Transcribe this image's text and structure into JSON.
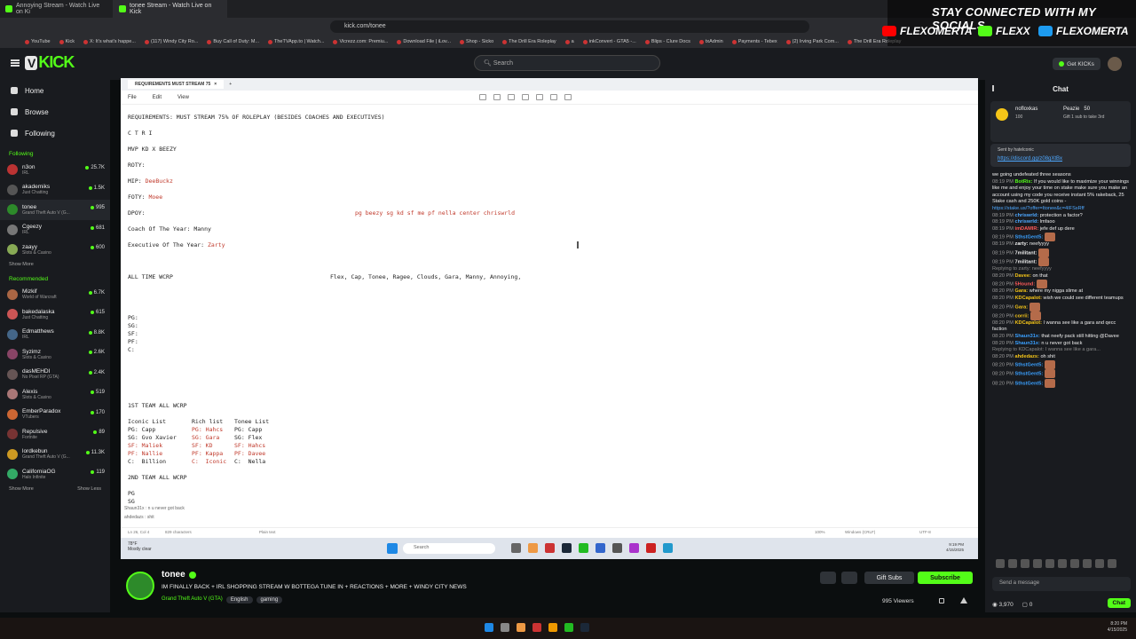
{
  "browser": {
    "tabs": [
      {
        "title": "Annoying Stream - Watch Live on Ki"
      },
      {
        "title": "tonee Stream - Watch Live on Kick"
      }
    ],
    "url": "kick.com/tonee",
    "bookmarks": [
      "YouTube",
      "Kick",
      "X: It's what's happe...",
      "(117) Windy City Ro...",
      "Buy Call of Duty: M...",
      "TheTVApp.to | Watch...",
      "Vicrezz.com: Premiu...",
      "Download File | iLov...",
      "Shop - Sicko",
      "The Drill Era Roleplay",
      "a",
      "inkConvert - GTA5 -...",
      "Blips - Clure Docs",
      "txAdmin",
      "Payments - Tebex",
      "(2) Irving Park Com...",
      "The Drill Era Roleplay"
    ]
  },
  "overlay": {
    "title": "STAY CONNECTED WITH MY SOCIALS",
    "socials": [
      {
        "handle": "FLEXOMERTA",
        "color": "#ff0000"
      },
      {
        "handle": "FLEXX",
        "color": "#53fc18"
      },
      {
        "handle": "FLEXOMERTA",
        "color": "#1d9bf0"
      }
    ]
  },
  "kick": {
    "logo": "KICK",
    "search_placeholder": "Search",
    "get_kicks": "Get KICKs"
  },
  "sidebar": {
    "nav": [
      {
        "label": "Home"
      },
      {
        "label": "Browse"
      },
      {
        "label": "Following"
      }
    ],
    "following_title": "Following",
    "following": [
      {
        "name": "n3on",
        "game": "IRL",
        "viewers": "25.7K",
        "color": "#b33"
      },
      {
        "name": "akademiks",
        "game": "Just Chatting",
        "viewers": "1.5K",
        "color": "#555"
      },
      {
        "name": "tonee",
        "game": "Grand Theft Auto V (G...",
        "viewers": "995",
        "color": "#2d8a2a"
      },
      {
        "name": "Cgeezy",
        "game": "IRL",
        "viewers": "681",
        "color": "#777"
      },
      {
        "name": "zaayy",
        "game": "Slots & Casino",
        "viewers": "600",
        "color": "#8a5"
      }
    ],
    "following_more": "Show More",
    "recommended_title": "Recommended",
    "recommended": [
      {
        "name": "Mizkif",
        "game": "World of Warcraft",
        "viewers": "6.7K",
        "color": "#a64"
      },
      {
        "name": "bakedalaska",
        "game": "Just Chatting",
        "viewers": "615",
        "color": "#c55"
      },
      {
        "name": "Edmatthews",
        "game": "IRL",
        "viewers": "8.8K",
        "color": "#468"
      },
      {
        "name": "Syzimz",
        "game": "Slots & Casino",
        "viewers": "2.6K",
        "color": "#846"
      },
      {
        "name": "dasMEHDI",
        "game": "No Pixel RP (GTA)",
        "viewers": "2.4K",
        "color": "#655"
      },
      {
        "name": "Alexis",
        "game": "Slots & Casino",
        "viewers": "519",
        "color": "#a77"
      },
      {
        "name": "EmberParadox",
        "game": "VTubers",
        "viewers": "170",
        "color": "#c63"
      },
      {
        "name": "Repulsive",
        "game": "Fortnite",
        "viewers": "89",
        "color": "#733"
      },
      {
        "name": "lordkebun",
        "game": "Grand Theft Auto V (G...",
        "viewers": "11.3K",
        "color": "#c92"
      },
      {
        "name": "CaliforniaOG",
        "game": "Halo Infinite",
        "viewers": "119",
        "color": "#3a6"
      }
    ],
    "rec_more": "Show More",
    "rec_less": "Show Less"
  },
  "stream": {
    "doc_tab": "REQUIREMENTS MUST STREAM 75",
    "menu": [
      "File",
      "Edit",
      "View"
    ],
    "lines": {
      "l1": "REQUIREMENTS: MUST STREAM 75% OF ROLEPLAY (BESIDES COACHES AND EXECUTIVES)",
      "l2": "C T R I",
      "l3": "MVP KD X BEEZY",
      "l4": "ROTY:",
      "l5a": "MIP: ",
      "l5b": "DeeBuckz",
      "l6a": "FOTY: ",
      "l6b": "Moee",
      "l7": "DPOY:",
      "l7b": "pg beezy sg kd sf me pf nella center chriswrld",
      "l8": "Coach Of The Year: Manny",
      "l9a": "Executive Of The Year: ",
      "l9b": "Zarty",
      "l10": "ALL TIME WCRP",
      "l10b": "Flex, Cap, Tonee, Ragee, Clouds, Gara, Manny, Annoying,",
      "pg": "PG:",
      "sg": "SG:",
      "sf": "SF:",
      "pf": "PF:",
      "c": "C:",
      "team1": "1ST TEAM ALL WCRP",
      "iconic_head": "Iconic List",
      "rich_head": "Rich list",
      "tonee_head": "Tonee List",
      "r1": [
        "PG: Capp",
        "PG: Hahcs",
        "PG: Capp"
      ],
      "r2": [
        "SG: Gvo Xavier",
        "SG: Gara",
        "SG: Flex"
      ],
      "r3": [
        "SF: Maliek",
        "SF: KD",
        "SF: Hahcs"
      ],
      "r4": [
        "PF: Nallie",
        "PF: Kappa",
        "PF: Davee"
      ],
      "r5": [
        "C:  Billion",
        "C:  Iconic",
        "C:  Nella"
      ],
      "team2": "2ND TEAM ALL WCRP",
      "pg2": "PG",
      "sg2": "SG"
    },
    "chat_overlay": [
      "Shaun31x : n u never got back",
      "ahdedazs : shit"
    ],
    "status": {
      "pos": "Ln 26, Col 4",
      "chars": "829 characters",
      "mode": "Plain text",
      "zoom": "100%",
      "eol": "Windows (CRLF)",
      "enc": "UTF-8"
    },
    "weather": {
      "temp": "78°F",
      "cond": "Mostly clear"
    },
    "task_search": "Search",
    "tray_time": "9:19 PM",
    "tray_date": "4/15/2025"
  },
  "chat": {
    "title": "Chat",
    "pinned": {
      "user": "nofloxkas",
      "count": "100",
      "user2": "Peazie",
      "amount": "50",
      "gift": "Gift 1 sub to take 3rd"
    },
    "sent_by": "Sent by hatelconic",
    "sent_link": "https://discord.gg/z08gXtBx",
    "messages": [
      {
        "time": "",
        "user": "",
        "color": "#eee",
        "text": "we going undefeated three seasons"
      },
      {
        "time": "08:19 PM",
        "user": "BotRix:",
        "color": "#53fc18",
        "text": "If you would like to maximize your winnings like me and enjoy your time on stake make sure you make an account using my code you receive instant 5% rakeback, 25 Stake cash and 250K gold coins -"
      },
      {
        "time": "",
        "user": "",
        "color": "#4ea8ff",
        "text": "https://stake.us/?offer=Itonee&c=4IFSsRff"
      },
      {
        "time": "08:19 PM",
        "user": "chriswrld:",
        "color": "#4ea8ff",
        "text": "protection a factor?"
      },
      {
        "time": "08:19 PM",
        "user": "chriswrld:",
        "color": "#4ea8ff",
        "text": "lmfaoo"
      },
      {
        "time": "08:19 PM",
        "user": "imDAMIR:",
        "color": "#ff5a5a",
        "text": "jefe def up dere"
      },
      {
        "time": "08:19 PM",
        "user": "SthstGent5:",
        "color": "#3aa0ff",
        "text": ""
      },
      {
        "time": "08:19 PM",
        "user": "zarty:",
        "color": "#eee",
        "text": "neefyyyy"
      },
      {
        "time": "08:19 PM",
        "user": "7militant:",
        "color": "#eee",
        "text": ""
      },
      {
        "time": "08:19 PM",
        "user": "7militant:",
        "color": "#eee",
        "text": ""
      },
      {
        "time": "",
        "user": "",
        "color": "#888",
        "text": "Replying to zarty: neefyyyy"
      },
      {
        "time": "08:20 PM",
        "user": "Davee:",
        "color": "#f5c518",
        "text": "on that"
      },
      {
        "time": "08:20 PM",
        "user": "5Hound:",
        "color": "#ff5a5a",
        "text": ""
      },
      {
        "time": "08:20 PM",
        "user": "Gara:",
        "color": "#f5c518",
        "text": "where my nigga slime at"
      },
      {
        "time": "08:20 PM",
        "user": "KDCapalot:",
        "color": "#f5c518",
        "text": "wish we could see different teamups"
      },
      {
        "time": "08:20 PM",
        "user": "Gara:",
        "color": "#f5c518",
        "text": ""
      },
      {
        "time": "08:20 PM",
        "user": "corrii:",
        "color": "#f5c518",
        "text": ""
      },
      {
        "time": "08:20 PM",
        "user": "KDCapalot:",
        "color": "#f5c518",
        "text": "I wanna see like a gara and qecc faction"
      },
      {
        "time": "08:20 PM",
        "user": "Shaun31x:",
        "color": "#3aa0ff",
        "text": "that neefy pack still hitting @Davee"
      },
      {
        "time": "08:20 PM",
        "user": "Shaun31x:",
        "color": "#3aa0ff",
        "text": "n u never got back"
      },
      {
        "time": "",
        "user": "",
        "color": "#888",
        "text": "Replying to KDCapalot: I wanna see like a gara..."
      },
      {
        "time": "08:20 PM",
        "user": "ahdedazs:",
        "color": "#f5c518",
        "text": "oh shit"
      },
      {
        "time": "08:20 PM",
        "user": "SthstGent5:",
        "color": "#3aa0ff",
        "text": ""
      },
      {
        "time": "08:20 PM",
        "user": "SthstGent5:",
        "color": "#3aa0ff",
        "text": ""
      },
      {
        "time": "08:20 PM",
        "user": "SthstGent5:",
        "color": "#3aa0ff",
        "text": ""
      }
    ],
    "input_placeholder": "Send a message",
    "kicks": "3,970",
    "zero": "0",
    "chat_button": "Chat"
  },
  "channel": {
    "name": "tonee",
    "title": "IM FINALLY BACK + IRL SHOPPING STREAM W BOTTEGA TUNE IN + REACTIONS + MORE + WINDY CITY NEWS",
    "category": "Grand Theft Auto V (GTA)",
    "tags": [
      "English",
      "gaming"
    ],
    "gift_subs": "Gift Subs",
    "subscribe": "Subscribe",
    "viewers": "995 Viewers"
  },
  "windows": {
    "time": "8:20 PM",
    "date": "4/15/2025"
  }
}
